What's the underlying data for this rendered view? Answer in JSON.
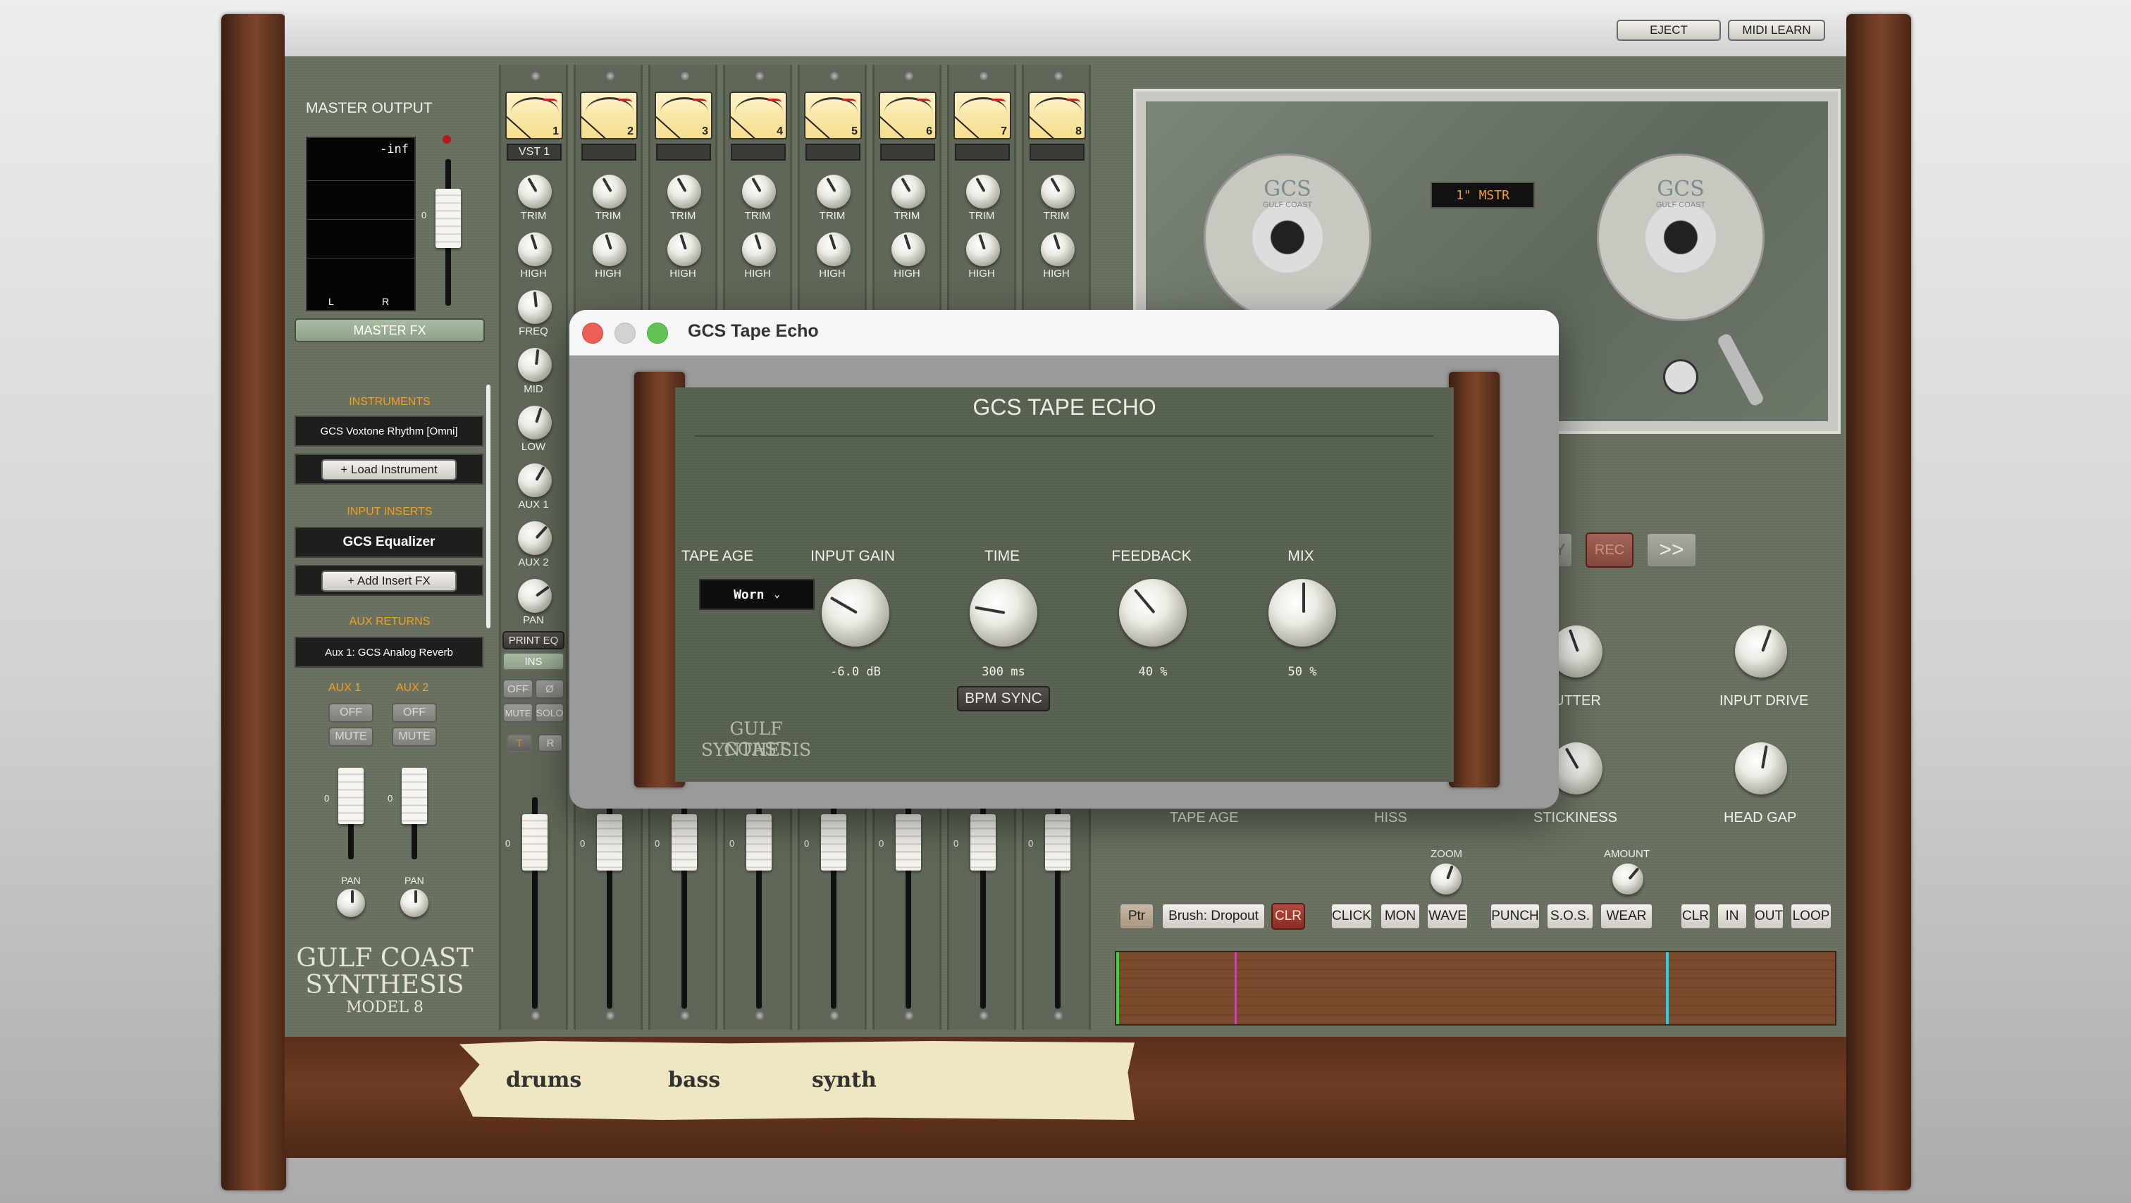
{
  "top_buttons": {
    "eject": "EJECT",
    "midi_learn": "MIDI LEARN"
  },
  "master": {
    "title": "MASTER OUTPUT",
    "meter_readout": "-inf",
    "left": "L",
    "right": "R",
    "fader_zero": "0",
    "fx_button": "MASTER FX"
  },
  "sections": {
    "instruments": "INSTRUMENTS",
    "instrument_slot": "GCS Voxtone Rhythm [Omni]",
    "load_instrument": "+ Load Instrument",
    "input_inserts": "INPUT INSERTS",
    "insert_slot": "GCS Equalizer",
    "add_insert": "+ Add Insert FX",
    "aux_returns": "AUX RETURNS",
    "aux_slot": "Aux 1: GCS Analog Reverb",
    "aux1": "AUX 1",
    "aux2": "AUX 2",
    "off": "OFF",
    "mute": "MUTE",
    "pan": "PAN",
    "zero": "0"
  },
  "branding": {
    "line1": "GULF COAST",
    "line2": "SYNTHESIS",
    "model": "MODEL 8"
  },
  "channel": {
    "names": [
      "1",
      "2",
      "3",
      "4",
      "5",
      "6",
      "7",
      "8"
    ],
    "first_label": "VST 1",
    "trim": "TRIM",
    "high": "HIGH",
    "freq": "FREQ",
    "mid": "MID",
    "low": "LOW",
    "aux1": "AUX 1",
    "aux2": "AUX 2",
    "pan": "PAN",
    "print_eq": "PRINT EQ",
    "ins": "INS",
    "off": "OFF",
    "phase": "Ø",
    "mute": "MUTE",
    "solo": "SOLO",
    "t": "T",
    "r": "R",
    "zero": "0"
  },
  "tape_machine": {
    "reel_brand": "GCS",
    "reel_sub": "GULF COAST",
    "display": "1\" MSTR",
    "rec": "REC",
    "ffwd": ">>",
    "y_partial": "Y",
    "knob_labels": [
      "LUTTER",
      "INPUT DRIVE",
      "TAPE AGE",
      "HISS",
      "STICKINESS",
      "HEAD GAP"
    ],
    "zoom": "ZOOM",
    "amount": "AMOUNT",
    "toolbar": [
      "Ptr",
      "Brush: Dropout",
      "CLR",
      "CLICK",
      "MON",
      "WAVE",
      "PUNCH",
      "S.O.S.",
      "WEAR",
      "CLR",
      "IN",
      "OUT",
      "LOOP"
    ]
  },
  "tape_labels": [
    "drums",
    "bass",
    "synth"
  ],
  "dialog": {
    "window_title": "GCS Tape Echo",
    "panel_title": "GCS TAPE ECHO",
    "tape_age_label": "TAPE AGE",
    "tape_age_value": "Worn",
    "params": [
      {
        "label": "INPUT GAIN",
        "value": "-6.0 dB"
      },
      {
        "label": "TIME",
        "value": "300 ms"
      },
      {
        "label": "FEEDBACK",
        "value": "40 %"
      },
      {
        "label": "MIX",
        "value": "50 %"
      }
    ],
    "bpm_sync": "BPM SYNC",
    "brand_line1": "GULF COAST",
    "brand_line2": "SYNTHESIS"
  },
  "colors": {
    "panel": "#67705f",
    "accent_orange": "#f0a020",
    "wood": "#6b3a23",
    "record_red": "#b04a3b"
  }
}
